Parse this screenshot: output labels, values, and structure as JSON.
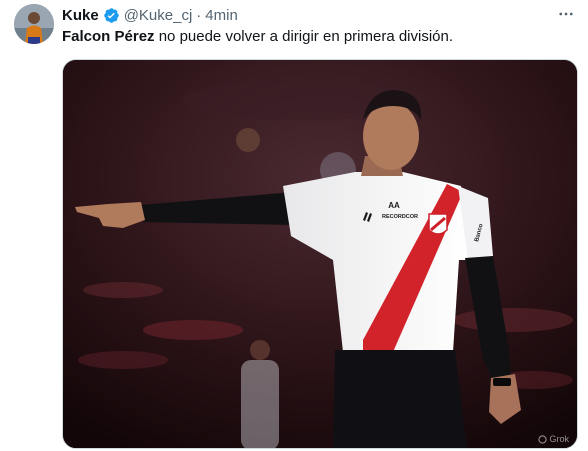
{
  "tweet": {
    "author_name": "Kuke",
    "handle": "@Kuke_cj",
    "separator": "·",
    "time": "4min",
    "text_bold": "Falcon Pérez",
    "text_rest": " no puede volver a dirigir en primera división.",
    "verified_color": "#1d9bf0"
  },
  "media": {
    "shirt_sponsor_logo": "AA",
    "shirt_sponsor_text": "RECORDCOR",
    "sleeve_text": "Banco",
    "watermark": "Grok"
  },
  "icons": {
    "verified": "verified-badge-icon",
    "more": "more-dots-icon",
    "crest": "river-plate-crest-icon"
  }
}
